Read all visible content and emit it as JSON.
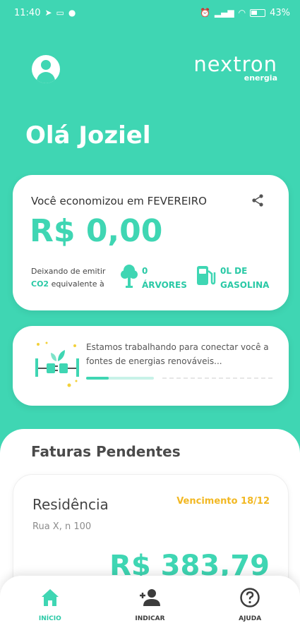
{
  "status_bar": {
    "time": "11:40",
    "battery": "43%"
  },
  "header": {
    "logo_main": "nextron",
    "logo_sub": "energia"
  },
  "greeting": "Olá Joziel",
  "savings": {
    "title": "Você economizou em FEVEREIRO",
    "value": "R$ 0,00",
    "emit_line1": "Deixando de emitir",
    "emit_co2": "CO2",
    "emit_line2": " equivalente à",
    "trees_count": "0",
    "trees_label": "ÁRVORES",
    "gas_count": "0L DE",
    "gas_label": "GASOLINA"
  },
  "info": {
    "message": "Estamos trabalhando para conectar você a fontes de energias renováveis...",
    "progress_fraction": 0.33
  },
  "pending": {
    "title": "Faturas Pendentes",
    "invoice": {
      "name": "Residência",
      "due": "Vencimento 18/12",
      "address": "Rua X, n 100",
      "amount": "R$ 383,79"
    }
  },
  "nav": {
    "items": [
      {
        "label": "INÍCIO",
        "icon": "home-icon",
        "active": true
      },
      {
        "label": "INDICAR",
        "icon": "add-person-icon",
        "active": false
      },
      {
        "label": "AJUDA",
        "icon": "help-icon",
        "active": false
      }
    ]
  },
  "colors": {
    "accent": "#3fd6b3",
    "warning": "#f2b823"
  }
}
